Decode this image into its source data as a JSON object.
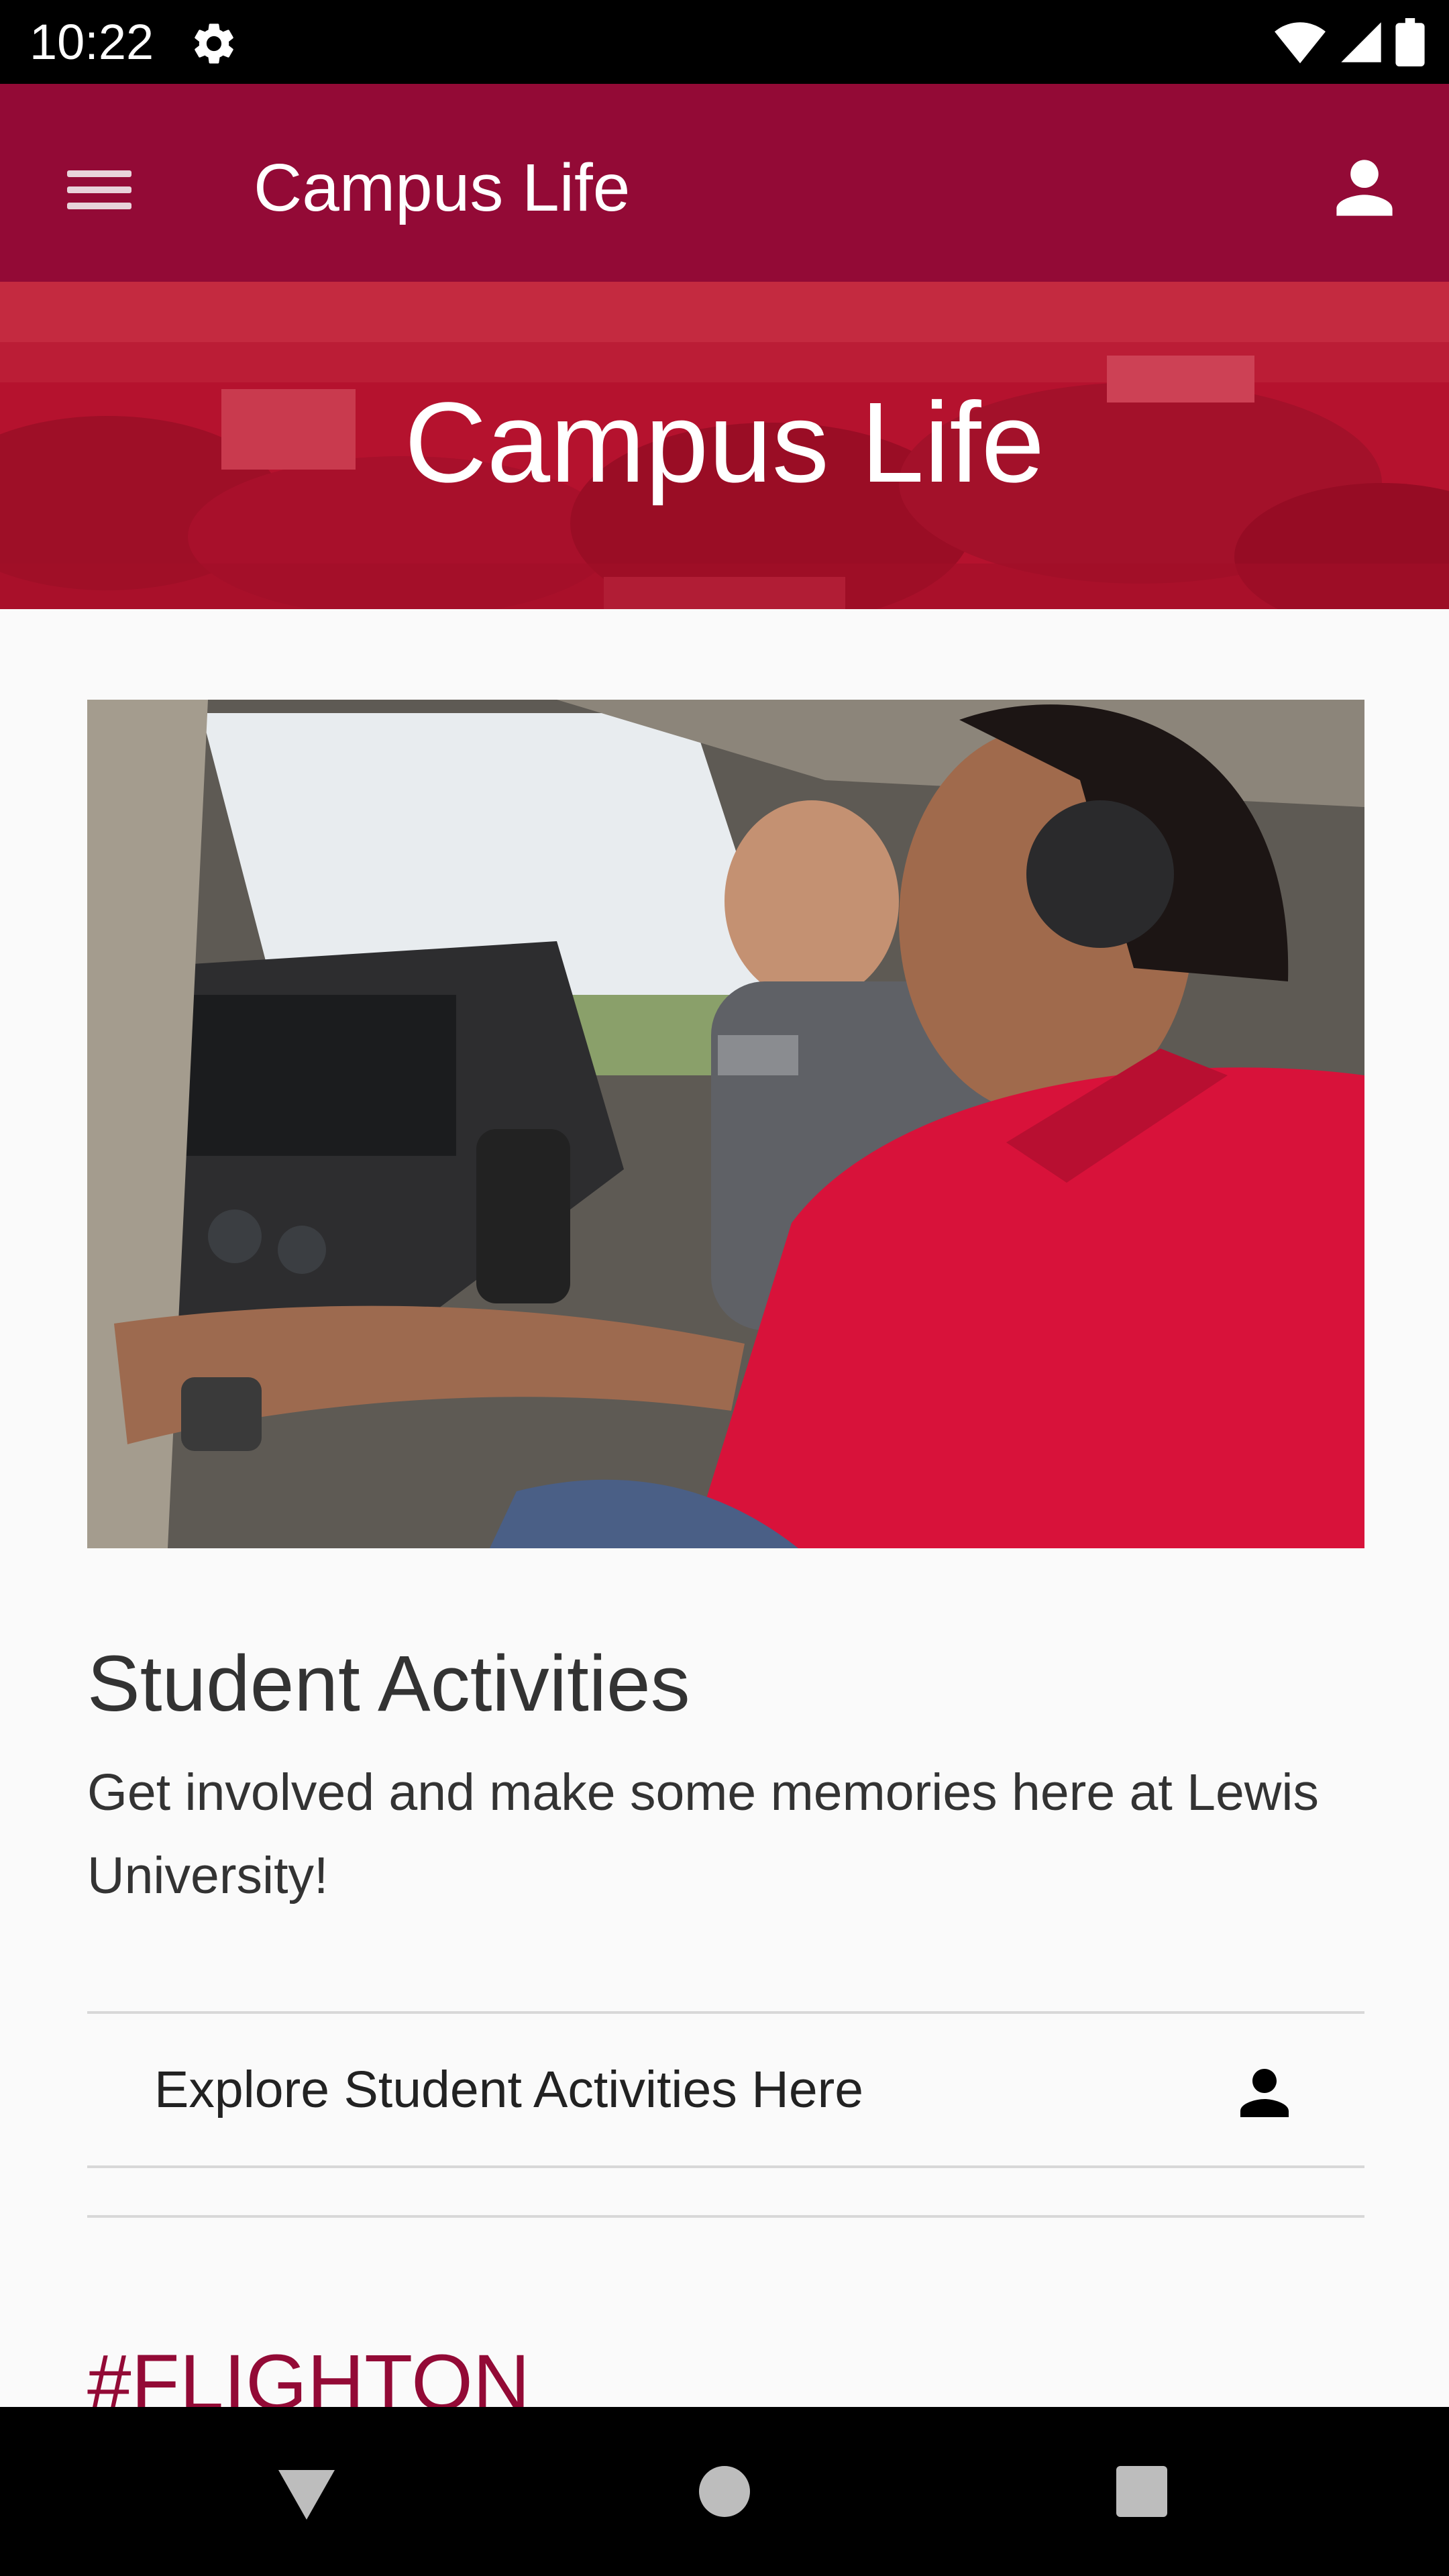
{
  "status_bar": {
    "time": "10:22",
    "icons": [
      "gear-icon",
      "wifi-icon",
      "signal-icon",
      "battery-icon"
    ]
  },
  "app_bar": {
    "title": "Campus Life",
    "menu_icon": "hamburger-menu-icon",
    "account_icon": "person-icon",
    "color": "#930a36"
  },
  "hero": {
    "title": "Campus Life",
    "overlay_color": "#b91430"
  },
  "main": {
    "image_alt": "Students in a small aircraft cockpit",
    "section_heading": "Student Activities",
    "section_body": "Get involved and make some memories here at Lewis University!",
    "explore_link": {
      "label": "Explore Student Activities Here",
      "icon": "person-icon"
    },
    "hashtag_heading": "#FLIGHTON",
    "accent_color": "#930a36"
  },
  "nav_bar": {
    "buttons": [
      "back-icon",
      "home-icon",
      "recents-icon"
    ]
  }
}
